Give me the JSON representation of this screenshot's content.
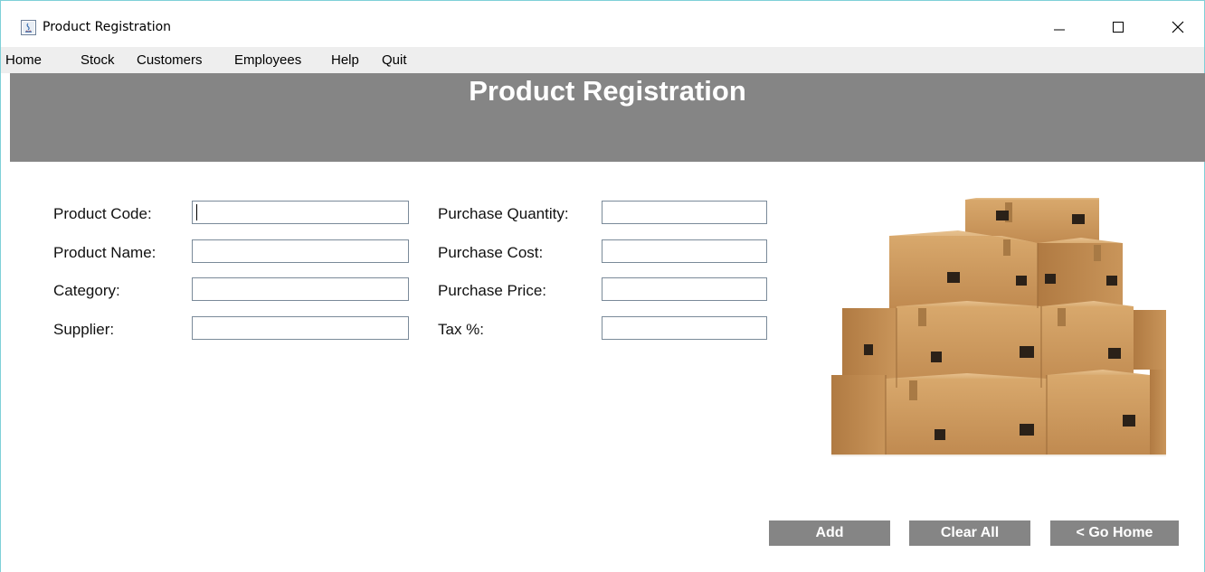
{
  "window": {
    "title": "Product Registration",
    "controls": {
      "minimize": "—",
      "maximize": "☐",
      "close": "✕"
    }
  },
  "menu": {
    "items": [
      "Home",
      "Stock",
      "Customers",
      "Employees",
      "Help",
      "Quit"
    ]
  },
  "header": {
    "title": "Product Registration"
  },
  "form": {
    "left": [
      {
        "label": "Product Code:",
        "value": ""
      },
      {
        "label": "Product Name:",
        "value": ""
      },
      {
        "label": "Category:",
        "value": ""
      },
      {
        "label": "Supplier:",
        "value": ""
      }
    ],
    "right": [
      {
        "label": "Purchase Quantity:",
        "value": ""
      },
      {
        "label": "Purchase Cost:",
        "value": ""
      },
      {
        "label": "Purchase Price:",
        "value": ""
      },
      {
        "label": "Tax %:",
        "value": ""
      }
    ]
  },
  "image": {
    "subject": "stack-of-cardboard-boxes"
  },
  "buttons": {
    "add": "Add",
    "clear": "Clear All",
    "home": "< Go Home"
  },
  "colors": {
    "header": "#858585",
    "button": "#858585",
    "menubar": "#eeeeee",
    "box": "#c9995f"
  }
}
